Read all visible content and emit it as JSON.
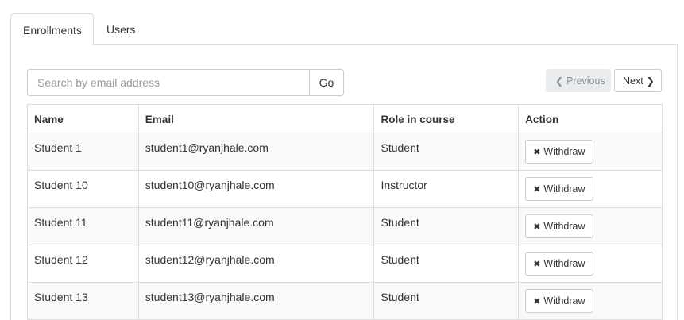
{
  "tabs": [
    {
      "label": "Enrollments",
      "active": true
    },
    {
      "label": "Users",
      "active": false
    }
  ],
  "search": {
    "placeholder": "Search by email address",
    "value": "",
    "go_label": "Go",
    "icon": "none"
  },
  "pager": {
    "previous_label": "Previous",
    "previous_icon": "chevron-left-icon",
    "previous_disabled": true,
    "next_label": "Next",
    "next_icon": "chevron-right-icon"
  },
  "table": {
    "columns": [
      "Name",
      "Email",
      "Role in course",
      "Action"
    ],
    "rows": [
      {
        "name": "Student 1",
        "email": "student1@ryanjhale.com",
        "role": "Student",
        "action": "Withdraw"
      },
      {
        "name": "Student 10",
        "email": "student10@ryanjhale.com",
        "role": "Instructor",
        "action": "Withdraw"
      },
      {
        "name": "Student 11",
        "email": "student11@ryanjhale.com",
        "role": "Student",
        "action": "Withdraw"
      },
      {
        "name": "Student 12",
        "email": "student12@ryanjhale.com",
        "role": "Student",
        "action": "Withdraw"
      },
      {
        "name": "Student 13",
        "email": "student13@ryanjhale.com",
        "role": "Student",
        "action": "Withdraw"
      }
    ],
    "action_icon": "close-icon"
  },
  "colors": {
    "border": "#dddddd",
    "stripe": "#f9f9f9",
    "disabled_button_bg": "#e8ecef",
    "disabled_button_text": "#8a949c"
  }
}
